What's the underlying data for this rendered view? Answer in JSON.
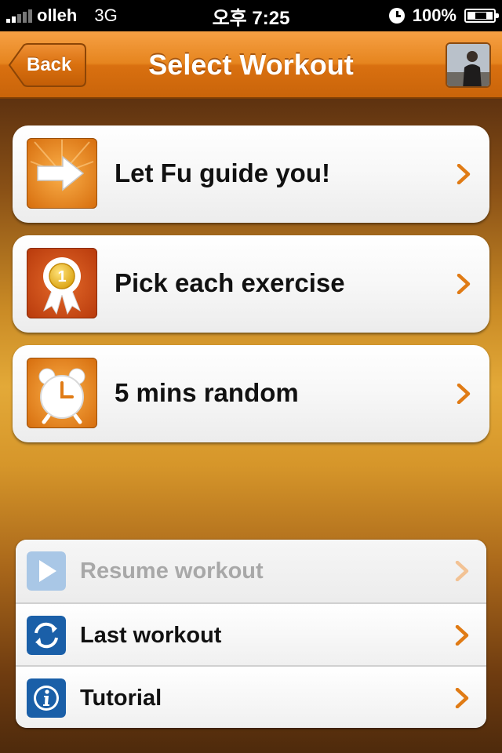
{
  "status_bar": {
    "carrier": "olleh",
    "network": "3G",
    "time": "오후 7:25",
    "battery": "100%",
    "icons": [
      "signal-icon",
      "lock-rotation-icon",
      "battery-charging-icon"
    ]
  },
  "nav": {
    "title": "Select Workout",
    "back_label": "Back",
    "avatar_icon": "profile-photo"
  },
  "workout_options": [
    {
      "label": "Let Fu guide you!",
      "icon": "arrow-right-icon"
    },
    {
      "label": "Pick each exercise",
      "icon": "ribbon-award-icon",
      "badge": "1"
    },
    {
      "label": "5 mins random",
      "icon": "alarm-clock-icon"
    }
  ],
  "secondary_options": [
    {
      "label": "Resume workout",
      "icon": "play-icon",
      "enabled": false
    },
    {
      "label": "Last workout",
      "icon": "refresh-icon",
      "enabled": true
    },
    {
      "label": "Tutorial",
      "icon": "info-icon",
      "enabled": true
    }
  ],
  "colors": {
    "accent": "#e07b15",
    "nav_top": "#f6a044",
    "nav_bottom": "#c9640a",
    "chevron": "#e07b15",
    "blue_icon": "#1a5fa8"
  }
}
